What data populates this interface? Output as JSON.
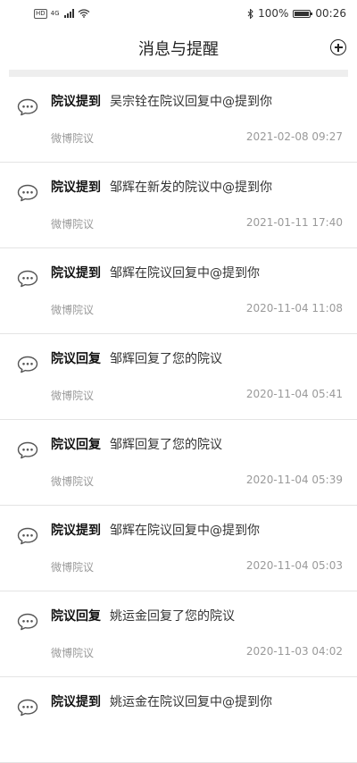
{
  "status_bar": {
    "network": "4G",
    "battery": "100%",
    "time": "00:26"
  },
  "header": {
    "title": "消息与提醒",
    "add_icon": "plus-circle-icon"
  },
  "messages": [
    {
      "type": "院议提到",
      "text": "吴宗铨在院议回复中@提到你",
      "source": "微博院议",
      "time": "2021-02-08 09:27"
    },
    {
      "type": "院议提到",
      "text": "邹辉在新发的院议中@提到你",
      "source": "微博院议",
      "time": "2021-01-11 17:40"
    },
    {
      "type": "院议提到",
      "text": "邹辉在院议回复中@提到你",
      "source": "微博院议",
      "time": "2020-11-04 11:08"
    },
    {
      "type": "院议回复",
      "text": "邹辉回复了您的院议",
      "source": "微博院议",
      "time": "2020-11-04 05:41"
    },
    {
      "type": "院议回复",
      "text": "邹辉回复了您的院议",
      "source": "微博院议",
      "time": "2020-11-04 05:39"
    },
    {
      "type": "院议提到",
      "text": "邹辉在院议回复中@提到你",
      "source": "微博院议",
      "time": "2020-11-04 05:03"
    },
    {
      "type": "院议回复",
      "text": "姚运金回复了您的院议",
      "source": "微博院议",
      "time": "2020-11-03 04:02"
    },
    {
      "type": "院议提到",
      "text": "姚运金在院议回复中@提到你",
      "source": "",
      "time": ""
    }
  ],
  "icons": {
    "message": "chat-bubble-icon"
  }
}
